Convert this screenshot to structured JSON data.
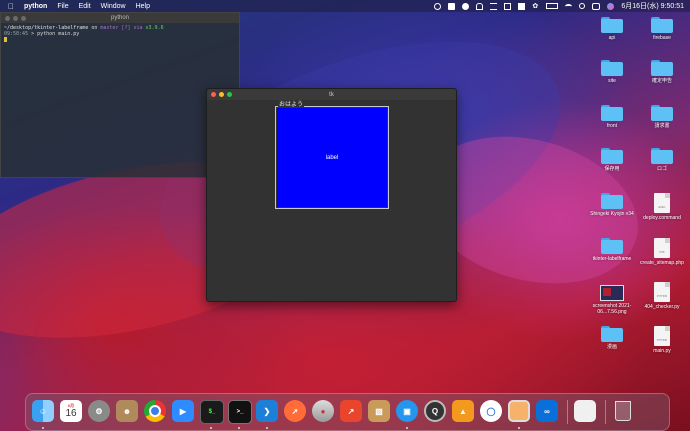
{
  "menubar": {
    "app_name": "python",
    "menus": [
      "File",
      "Edit",
      "Window",
      "Help"
    ],
    "datetime": "6月16日(水) 9:50:51"
  },
  "terminal": {
    "title": "python",
    "line1_path": "~/desktop/tkinter-labelframe",
    "line1_on": "on",
    "line1_branch": "master [?] via",
    "line1_version": "v3.9.6",
    "line2_time": "09:50:45",
    "line2_cmd": "> python  main.py"
  },
  "tk_window": {
    "title": "tk",
    "labelframe_text": "おはよう",
    "label_text": "label",
    "frame_color": "#0000ff"
  },
  "desktop": {
    "icons": [
      {
        "label": "api",
        "type": "folder"
      },
      {
        "label": "firebase",
        "type": "folder"
      },
      {
        "label": "site",
        "type": "folder"
      },
      {
        "label": "確定申告",
        "type": "folder"
      },
      {
        "label": "front",
        "type": "folder"
      },
      {
        "label": "請求書",
        "type": "folder"
      },
      {
        "label": "保存用",
        "type": "folder"
      },
      {
        "label": "ロゴ",
        "type": "folder"
      },
      {
        "label": "Shingeki Kyojin v34",
        "type": "folder"
      },
      {
        "label": "deploy.command",
        "type": "doc",
        "tag": "EXEC"
      },
      {
        "label": "tkinter-labelframe",
        "type": "folder"
      },
      {
        "label": "create_sitemap.php",
        "type": "doc",
        "tag": "PHP"
      },
      {
        "label": "screenshot 2021-06...7.56.png",
        "type": "image"
      },
      {
        "label": "404_checker.py",
        "type": "doc",
        "tag": "PYTHON"
      },
      {
        "label": "漫画",
        "type": "folder"
      },
      {
        "label": "main.py",
        "type": "doc",
        "tag": "PYTHON"
      }
    ]
  },
  "dock": {
    "calendar_month": "6月",
    "calendar_day": "16",
    "apps": [
      "finder",
      "calendar",
      "system-preferences",
      "contacts",
      "chrome",
      "zoom",
      "terminal-green",
      "terminal",
      "vscode",
      "postman",
      "sequel",
      "reeder",
      "archive-utility",
      "docker",
      "quicktime",
      "sourcetree",
      "proxyman",
      "preview",
      "infinity"
    ]
  }
}
